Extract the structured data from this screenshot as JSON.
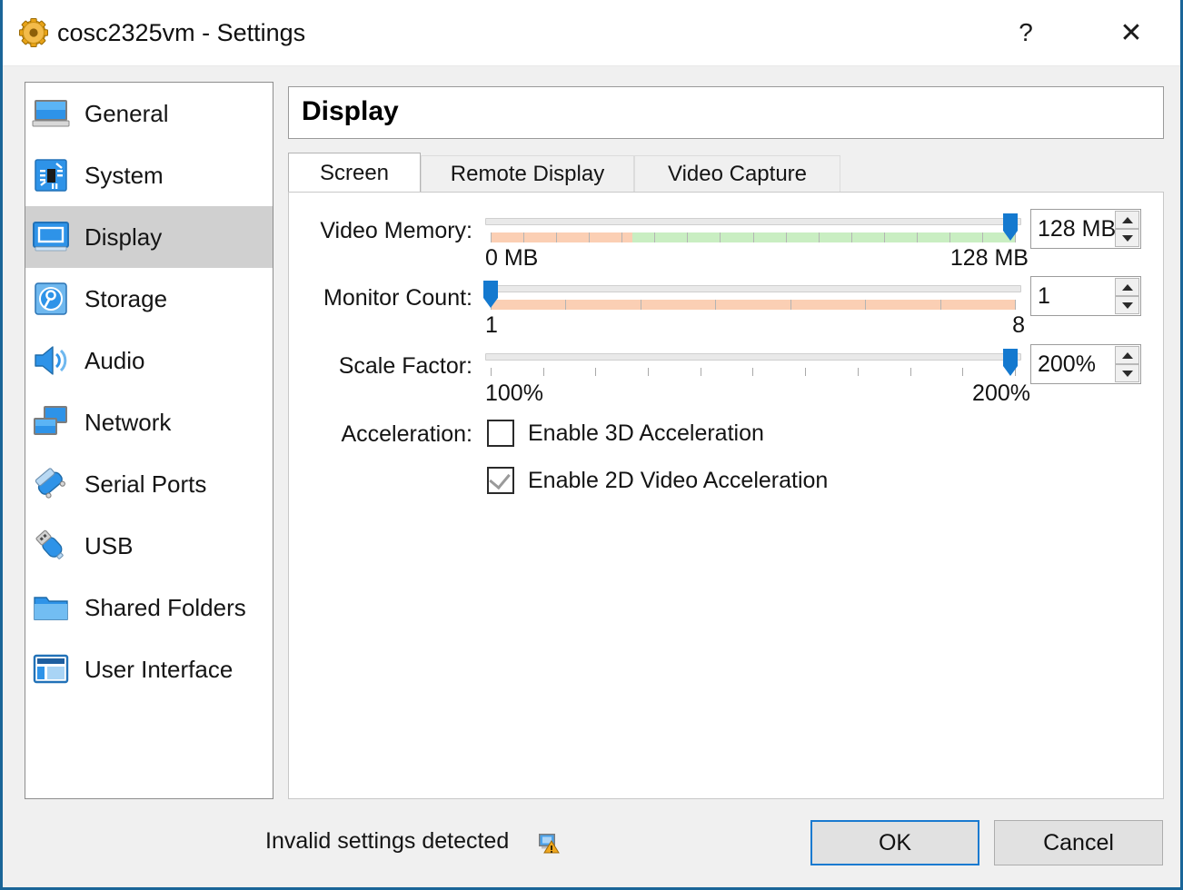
{
  "window": {
    "title": "cosc2325vm - Settings",
    "icon": "settings-gear-icon",
    "help_label": "?",
    "close_label": "✕",
    "border_color": "#1a6598"
  },
  "sidebar": {
    "items": [
      {
        "label": "General",
        "icon": "monitor-general-icon",
        "selected": false
      },
      {
        "label": "System",
        "icon": "motherboard-icon",
        "selected": false
      },
      {
        "label": "Display",
        "icon": "display-monitor-icon",
        "selected": true
      },
      {
        "label": "Storage",
        "icon": "hard-disk-icon",
        "selected": false
      },
      {
        "label": "Audio",
        "icon": "speaker-icon",
        "selected": false
      },
      {
        "label": "Network",
        "icon": "network-cards-icon",
        "selected": false
      },
      {
        "label": "Serial Ports",
        "icon": "serial-port-icon",
        "selected": false
      },
      {
        "label": "USB",
        "icon": "usb-stick-icon",
        "selected": false
      },
      {
        "label": "Shared Folders",
        "icon": "folder-icon",
        "selected": false
      },
      {
        "label": "User Interface",
        "icon": "window-layout-icon",
        "selected": false
      }
    ]
  },
  "header": {
    "title": "Display"
  },
  "tabs": [
    {
      "label": "Screen",
      "active": true
    },
    {
      "label": "Remote Display",
      "active": false
    },
    {
      "label": "Video Capture",
      "active": false
    }
  ],
  "screen": {
    "video_memory": {
      "label": "Video Memory:",
      "min_label": "0 MB",
      "max_label": "128 MB",
      "value": "128 MB",
      "handle_percent": 100,
      "warn_percent": 27,
      "tick_count": 17
    },
    "monitor_count": {
      "label": "Monitor Count:",
      "min_label": "1",
      "max_label": "8",
      "value": "1",
      "handle_percent": 0,
      "warn_percent": 100,
      "tick_count": 8
    },
    "scale_factor": {
      "label": "Scale Factor:",
      "min_label": "100%",
      "max_label": "200%",
      "value": "200%",
      "handle_percent": 100,
      "tick_count": 11
    },
    "acceleration": {
      "label": "Acceleration:",
      "options": [
        {
          "label": "Enable 3D Acceleration",
          "checked": false
        },
        {
          "label": "Enable 2D Video Acceleration",
          "checked": true
        }
      ]
    }
  },
  "footer": {
    "status_text": "Invalid settings detected",
    "status_icon": "display-warning-icon",
    "ok_label": "OK",
    "cancel_label": "Cancel"
  },
  "colors": {
    "accent": "#1a7ad0",
    "slider_handle": "#1479cf",
    "warn_range": "#fbcfb4",
    "ok_range": "#c9eec2",
    "selection": "#d0d0d0"
  }
}
